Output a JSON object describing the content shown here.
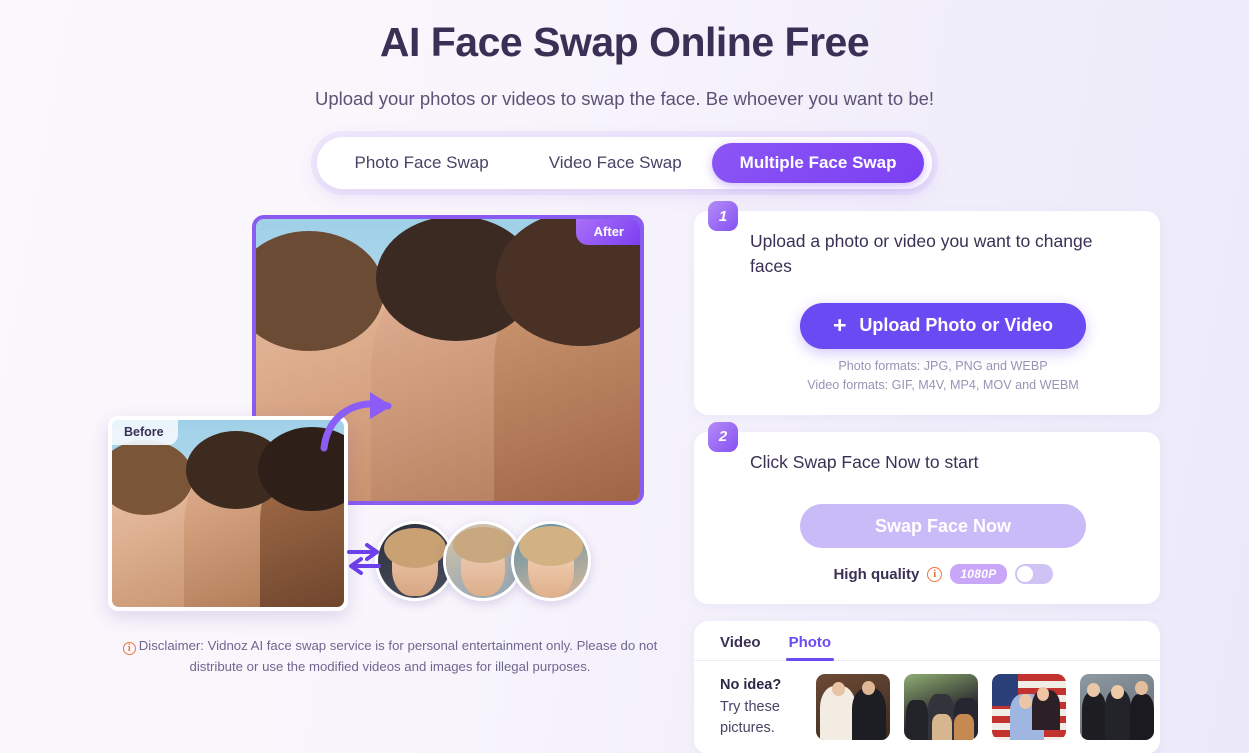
{
  "header": {
    "title": "AI Face Swap Online Free",
    "subtitle": "Upload your photos or videos to swap the face. Be whoever you want to be!"
  },
  "tabs": [
    {
      "label": "Photo Face Swap",
      "active": false
    },
    {
      "label": "Video Face Swap",
      "active": false
    },
    {
      "label": "Multiple Face Swap",
      "active": true
    }
  ],
  "preview": {
    "after_badge": "After",
    "before_badge": "Before",
    "swap_icon": "swap-horizontal-icon",
    "arrow_icon": "curved-arrow-icon",
    "faces": [
      "face-thumbnail-1",
      "face-thumbnail-2",
      "face-thumbnail-3"
    ],
    "disclaimer_icon": "info-icon",
    "disclaimer": "Disclaimer: Vidnoz AI face swap service is for personal entertainment only. Please do not distribute or use the modified videos and images for illegal purposes."
  },
  "step1": {
    "number": "1",
    "title": "Upload a photo or video you want to change faces",
    "upload_label": "Upload Photo or Video",
    "plus_icon": "plus-icon",
    "photo_formats": "Photo formats: JPG, PNG and WEBP",
    "video_formats": "Video formats: GIF, M4V, MP4, MOV and WEBM"
  },
  "step2": {
    "number": "2",
    "title": "Click Swap Face Now to start",
    "swap_label": "Swap Face Now",
    "quality_label": "High quality",
    "info_icon": "info-icon",
    "resolution_badge": "1080P",
    "toggle_state": "off"
  },
  "gallery": {
    "tabs": [
      {
        "label": "Video",
        "active": false
      },
      {
        "label": "Photo",
        "active": true
      }
    ],
    "prompt_strong": "No idea?",
    "prompt_rest": "Try these pictures.",
    "thumbnails": [
      "wedding-couple-thumbnail",
      "friends-group-thumbnail",
      "couple-flag-thumbnail",
      "wizards-trio-thumbnail"
    ]
  },
  "colors": {
    "accent": "#6a4af2",
    "accent_light": "#8b56f5",
    "badge": "#c9a6f7",
    "text_dark": "#3a3055",
    "info": "#f0743c"
  }
}
